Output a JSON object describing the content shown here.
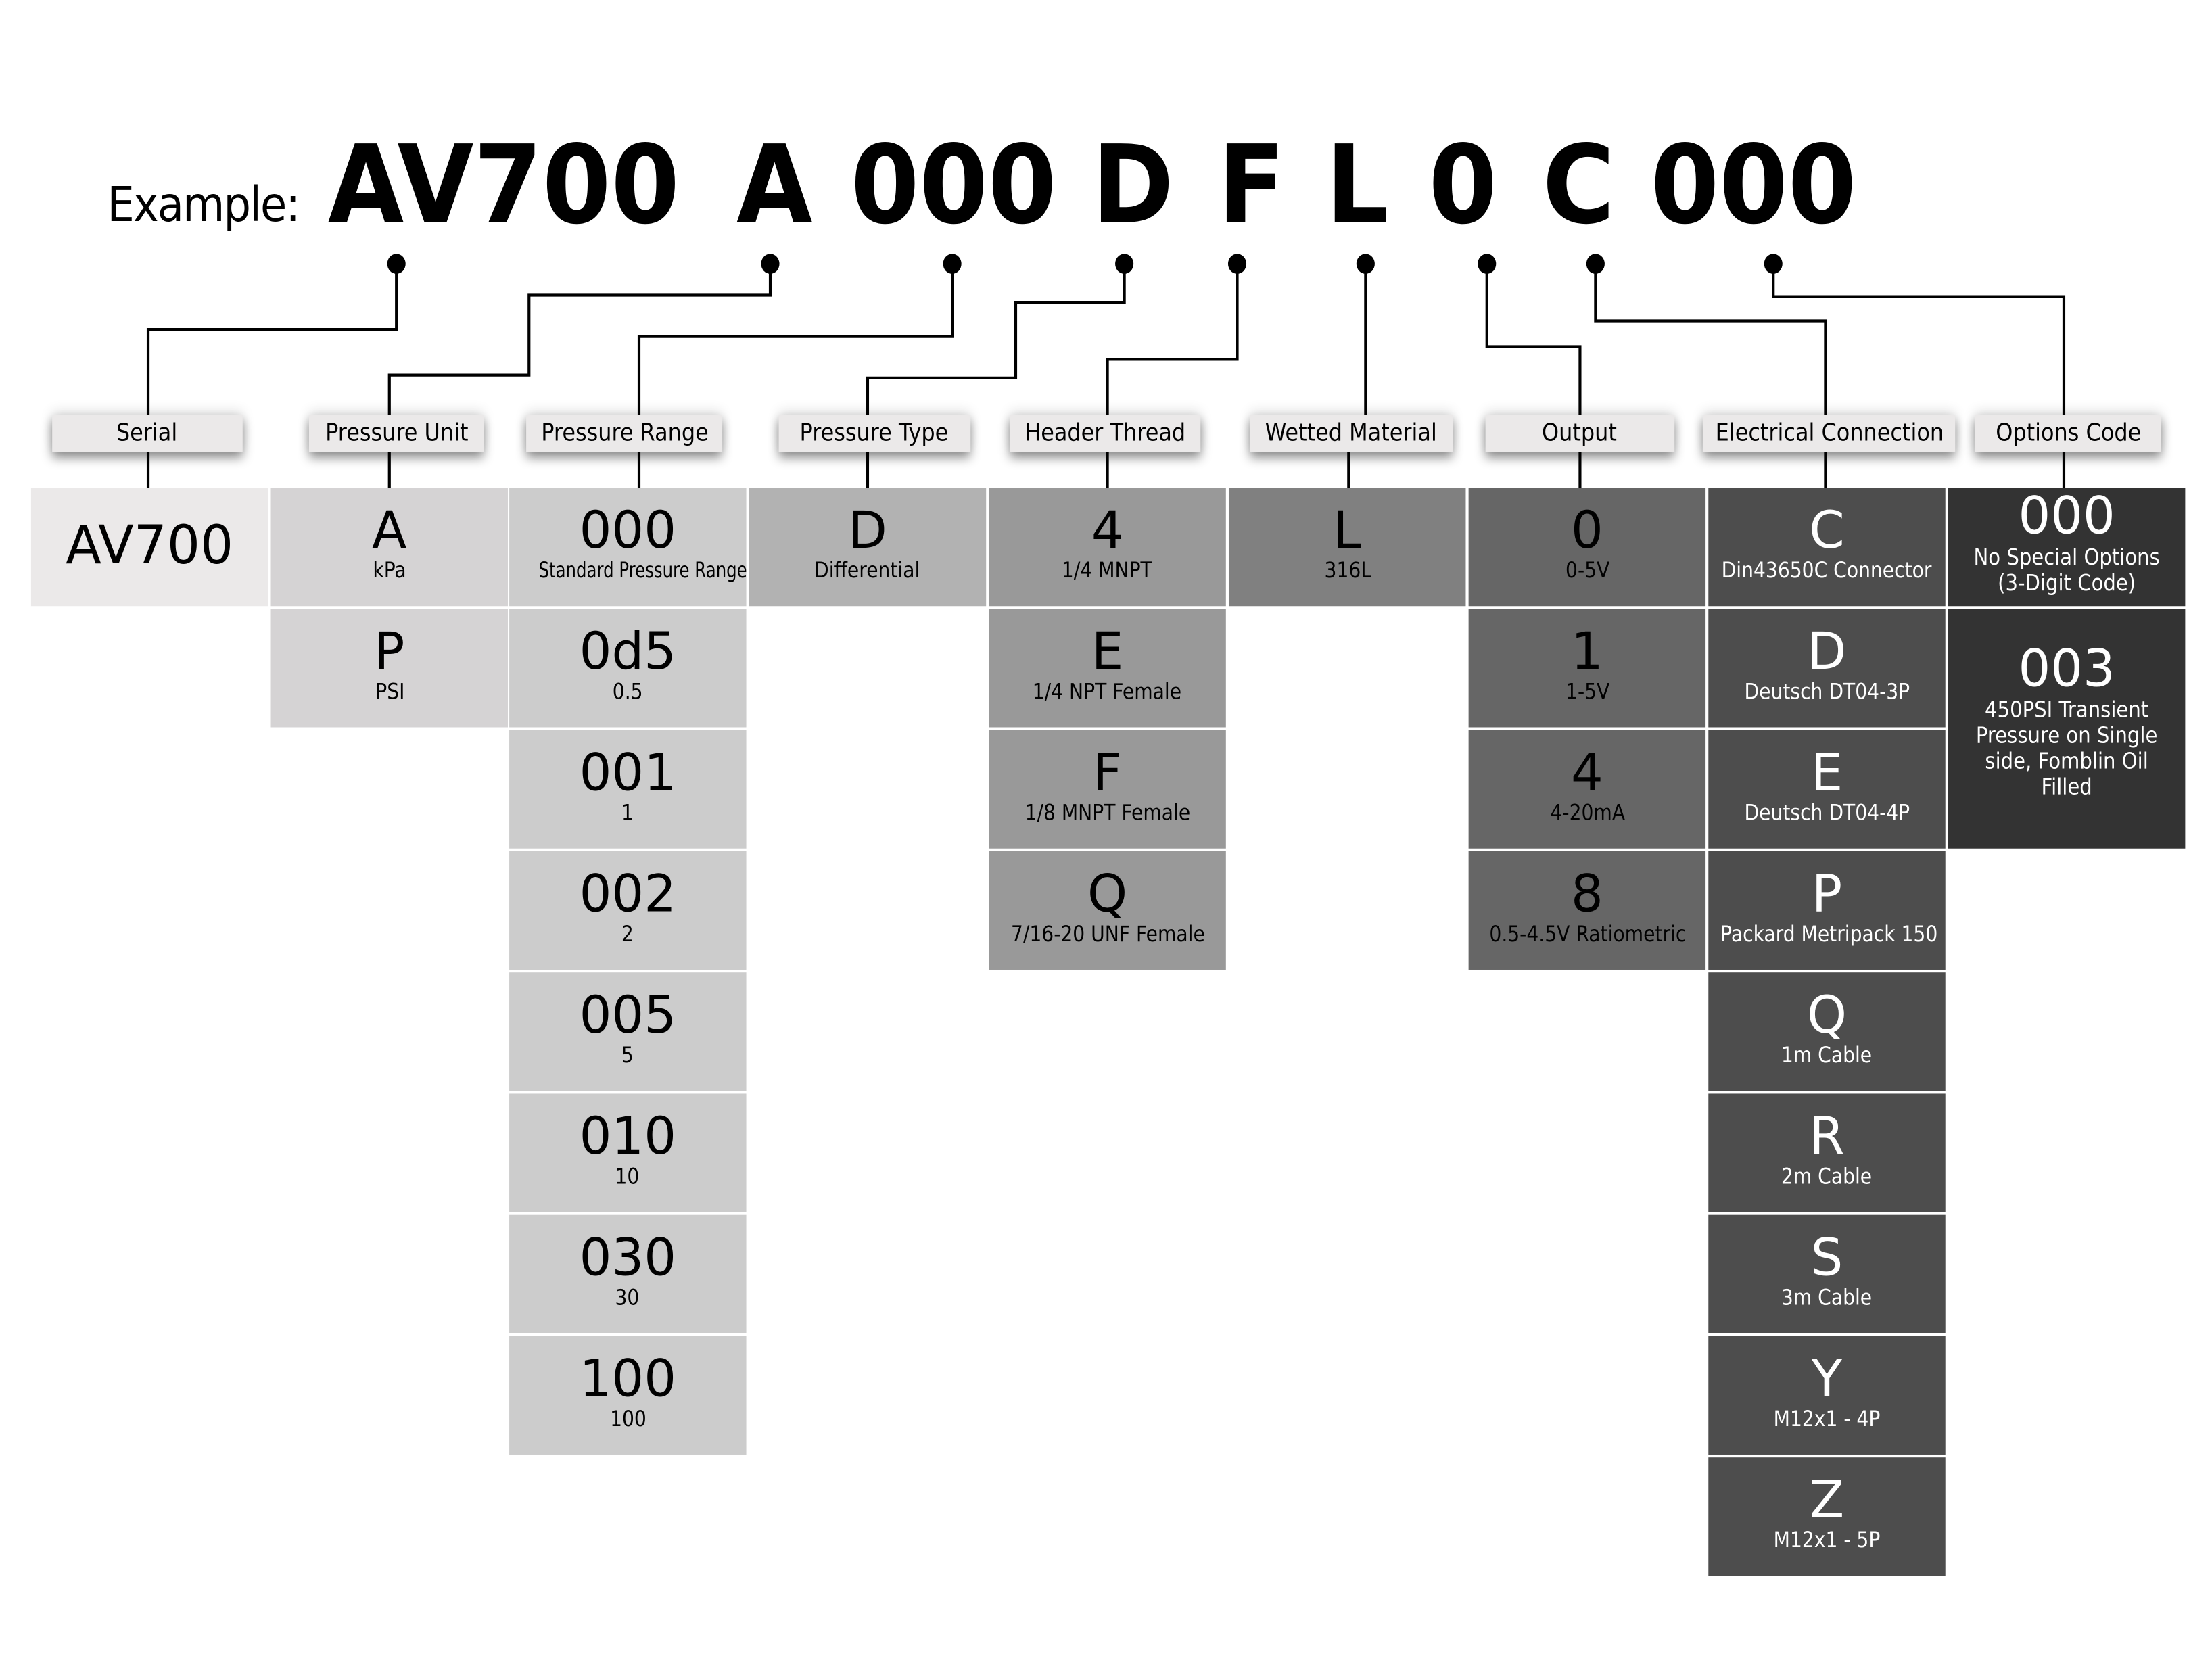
{
  "example": {
    "label": "Example:",
    "parts": [
      "AV700",
      "A",
      "000",
      "D",
      "F",
      "L",
      "0",
      "C",
      "000"
    ]
  },
  "colors": {
    "serial": "#ebe9e9",
    "pressure_unit": "#d5d3d4",
    "pressure_range": "#cccccc",
    "pressure_type": "#b2b2b2",
    "header_thread": "#999999",
    "wetted_material": "#808080",
    "output": "#666666",
    "electrical_connection": "#4d4d4d",
    "options_code": "#333333",
    "header_label_bg": "#ebe9e9"
  },
  "columns": [
    {
      "header": "Serial",
      "options": [
        {
          "code": "AV700",
          "desc": ""
        }
      ]
    },
    {
      "header": "Pressure Unit",
      "options": [
        {
          "code": "A",
          "desc": "kPa"
        },
        {
          "code": "P",
          "desc": "PSI"
        }
      ]
    },
    {
      "header": "Pressure Range",
      "options": [
        {
          "code": "000",
          "desc": "Standard Pressure Range"
        },
        {
          "code": "0d5",
          "desc": "0.5"
        },
        {
          "code": "001",
          "desc": "1"
        },
        {
          "code": "002",
          "desc": "2"
        },
        {
          "code": "005",
          "desc": "5"
        },
        {
          "code": "010",
          "desc": "10"
        },
        {
          "code": "030",
          "desc": "30"
        },
        {
          "code": "100",
          "desc": "100"
        }
      ]
    },
    {
      "header": "Pressure Type",
      "options": [
        {
          "code": "D",
          "desc": "Differential"
        }
      ]
    },
    {
      "header": "Header Thread",
      "options": [
        {
          "code": "4",
          "desc": "1/4 MNPT"
        },
        {
          "code": "E",
          "desc": "1/4 NPT Female"
        },
        {
          "code": "F",
          "desc": "1/8 MNPT Female"
        },
        {
          "code": "Q",
          "desc": "7/16-20 UNF Female"
        }
      ]
    },
    {
      "header": "Wetted Material",
      "options": [
        {
          "code": "L",
          "desc": "316L"
        }
      ]
    },
    {
      "header": "Output",
      "options": [
        {
          "code": "0",
          "desc": "0-5V"
        },
        {
          "code": "1",
          "desc": "1-5V"
        },
        {
          "code": "4",
          "desc": "4-20mA"
        },
        {
          "code": "8",
          "desc": "0.5-4.5V Ratiometric"
        }
      ]
    },
    {
      "header": "Electrical Connection",
      "options": [
        {
          "code": "C",
          "desc": "Din43650C Connector"
        },
        {
          "code": "D",
          "desc": "Deutsch DT04-3P"
        },
        {
          "code": "E",
          "desc": "Deutsch DT04-4P"
        },
        {
          "code": "P",
          "desc": "Packard Metripack 150"
        },
        {
          "code": "Q",
          "desc": "1m Cable"
        },
        {
          "code": "R",
          "desc": "2m Cable"
        },
        {
          "code": "S",
          "desc": "3m Cable"
        },
        {
          "code": "Y",
          "desc": "M12x1 - 4P"
        },
        {
          "code": "Z",
          "desc": "M12x1 - 5P"
        }
      ]
    },
    {
      "header": "Options Code",
      "options": [
        {
          "code": "000",
          "desc": "No Special Options (3-Digit Code)"
        },
        {
          "code": "003",
          "desc": "450PSI Transient Pressure on Single side, Fomblin Oil Filled"
        }
      ]
    }
  ]
}
